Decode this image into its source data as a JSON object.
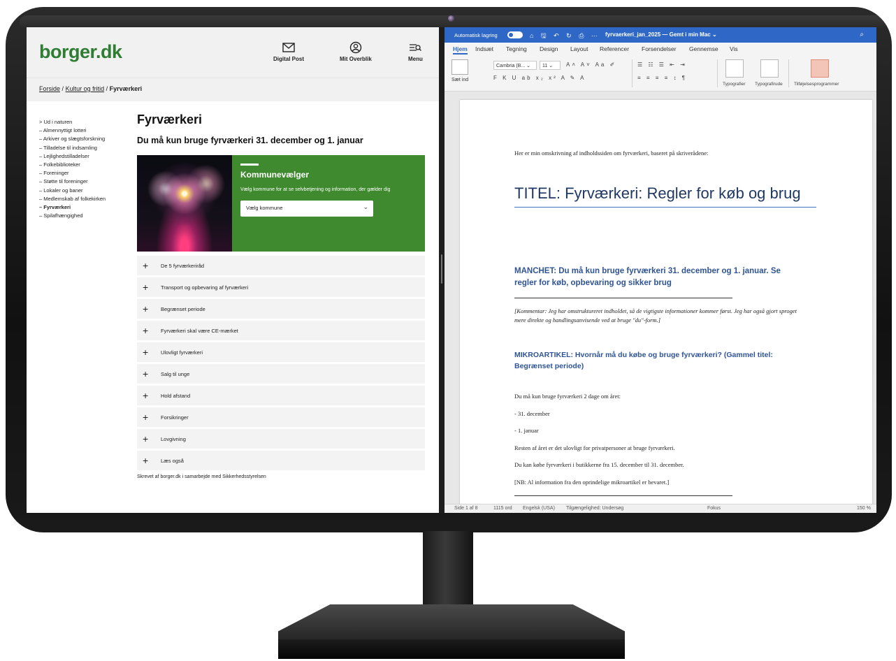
{
  "borger": {
    "logo": "borger.dk",
    "nav": {
      "digital_post": "Digital Post",
      "mit_overblik": "Mit Overblik",
      "menu": "Menu"
    },
    "breadcrumb": {
      "home": "Forside",
      "sep1": "/",
      "parent": "Kultur og fritid",
      "sep2": "/",
      "current": "Fyrværkeri"
    },
    "sidebar": [
      "> Ud i naturen",
      "– Almennyttigt lotteri",
      "– Arkiver og slægtsforskning",
      "– Tilladelse til indsamling",
      "– Lejlighedstilladelser",
      "– Folkebiblioteker",
      "– Foreninger",
      "– Støtte til foreninger",
      "– Lokaler og baner",
      "– Medlemskab af folkekirken",
      "– Fyrværkeri",
      "– Spilafhængighed"
    ],
    "title": "Fyrværkeri",
    "subtitle": "Du må kun bruge fyrværkeri 31. december og 1. januar",
    "kommune": {
      "title": "Kommunevælger",
      "desc": "Vælg kommune for at se selvbetjening og information, der gælder dig",
      "select_value": "Vælg kommune"
    },
    "accordion": [
      "De 5 fyrværkeriråd",
      "Transport og opbevaring af fyrværkeri",
      "Begrænset periode",
      "Fyrværkeri skal være CE-mærket",
      "Ulovligt fyrværkeri",
      "Salg til unge",
      "Hold afstand",
      "Forsikringer",
      "Lovgivning",
      "Læs også"
    ],
    "footer": "Skrevet af borger.dk i samarbejde med Sikkerhedsstyrelsen"
  },
  "word": {
    "titlebar": {
      "autosave": "Automatisk lagring",
      "toggle": "FRA",
      "doc_title": "fyrvaerkeri_jan_2025 — Gemt i min Mac ⌄"
    },
    "tabs": [
      "Hjem",
      "Indsæt",
      "Tegning",
      "Design",
      "Layout",
      "Referencer",
      "Forsendelser",
      "Gennemse",
      "Vis"
    ],
    "ribbon": {
      "paste": "Sæt ind",
      "font": "Cambria (B... ⌄",
      "size": "11 ⌄",
      "styles": "Typografier",
      "styles_pane": "Typografirude",
      "addins": "Tilføjelsesprogrammer"
    },
    "doc": {
      "intro": "Her er min omskrivning af indholdssiden om fyrværkeri, baseret på skriverådene:",
      "title": "TITEL: Fyrværkeri: Regler for køb og brug",
      "manchet": "MANCHET: Du må kun bruge fyrværkeri 31. december og 1. januar. Se regler for køb, opbevaring og sikker brug",
      "comment": "[Kommentar: Jeg har omstruktureret indholdet, så de vigtigste informationer kommer først. Jeg har også gjort sproget mere direkte og handlingsanvisende ved at bruge \"du\"-form.]",
      "mikro": "MIKROARTIKEL: Hvornår må du købe og bruge fyrværkeri? (Gammel titel: Begrænset periode)",
      "body": [
        "Du må kun bruge fyrværkeri 2 dage om året:",
        "- 31. december",
        "- 1. januar",
        "Resten af året er det ulovligt for privatpersoner at bruge fyrværkeri.",
        "Du kan købe fyrværkeri i butikkerne fra 15. december til 31. december.",
        "[NB: Al information fra den oprindelige mikroartikel er bevaret.]"
      ]
    },
    "status": {
      "page": "Side 1 af 8",
      "words": "1115 ord",
      "lang": "Engelsk (USA)",
      "access": "Tilgængelighed: Undersøg",
      "focus": "Fokus",
      "zoom": "150 %"
    }
  },
  "colors": {
    "borger_green": "#3f8a2f",
    "logo_green": "#2e7d32",
    "word_blue": "#2f67c6",
    "heading_blue": "#2f5496"
  }
}
